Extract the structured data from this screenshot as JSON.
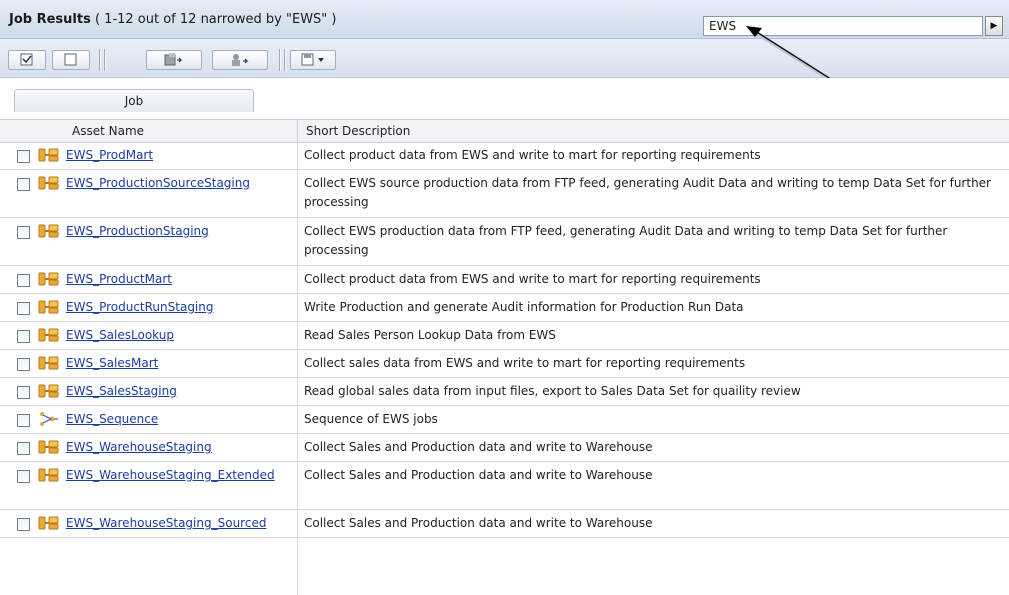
{
  "header": {
    "title_bold": "Job Results",
    "title_rest": "( 1-12 out of 12 narrowed by \"EWS\" )"
  },
  "search": {
    "value": "EWS"
  },
  "go_button": {
    "glyph": "▶"
  },
  "toolbar": {
    "buttons": [
      {
        "name": "select-all-button",
        "icon": "checkbox-checked-icon"
      },
      {
        "name": "deselect-all-button",
        "icon": "checkbox-empty-icon"
      },
      {
        "name": "assign-asset-button",
        "icon": "folder-assign-icon"
      },
      {
        "name": "assign-user-button",
        "icon": "user-assign-icon"
      },
      {
        "name": "export-menu-button",
        "icon": "save-dropdown-icon"
      }
    ]
  },
  "tabs": [
    {
      "label": "Job"
    }
  ],
  "table": {
    "columns": [
      "Asset Name",
      "Short Description"
    ],
    "rows": [
      {
        "name": "EWS_ProdMart",
        "desc": "Collect product data from EWS and write to mart for reporting requirements",
        "icon": "parallel-job-icon"
      },
      {
        "name": "EWS_ProductionSourceStaging",
        "desc": "Collect EWS source production data from FTP feed, generating Audit Data and writing to temp Data Set for further processing",
        "icon": "parallel-job-icon"
      },
      {
        "name": "EWS_ProductionStaging",
        "desc": "Collect EWS production data from FTP feed, generating Audit Data and writing to temp Data Set for further processing",
        "icon": "parallel-job-icon"
      },
      {
        "name": "EWS_ProductMart",
        "desc": "Collect product data from EWS and write to mart for reporting requirements",
        "icon": "parallel-job-icon"
      },
      {
        "name": "EWS_ProductRunStaging",
        "desc": "Write Production and generate Audit information for Production Run Data",
        "icon": "parallel-job-icon"
      },
      {
        "name": "EWS_SalesLookup",
        "desc": "Read Sales Person Lookup Data from EWS",
        "icon": "parallel-job-icon"
      },
      {
        "name": "EWS_SalesMart",
        "desc": "Collect sales data from EWS and write to mart for reporting requirements",
        "icon": "parallel-job-icon"
      },
      {
        "name": "EWS_SalesStaging",
        "desc": "Read global sales data from input files, export to Sales Data Set for quaility review",
        "icon": "parallel-job-icon"
      },
      {
        "name": "EWS_Sequence",
        "desc": "Sequence of EWS jobs",
        "icon": "sequence-job-icon"
      },
      {
        "name": "EWS_WarehouseStaging",
        "desc": "Collect Sales and Production data and write to Warehouse",
        "icon": "parallel-job-icon"
      },
      {
        "name": "EWS_WarehouseStaging_Extended",
        "desc": "Collect Sales and Production data and write to Warehouse",
        "icon": "parallel-job-icon"
      },
      {
        "name": "EWS_WarehouseStaging_Sourced",
        "desc": "Collect Sales and Production data and write to Warehouse",
        "icon": "parallel-job-icon"
      }
    ]
  }
}
